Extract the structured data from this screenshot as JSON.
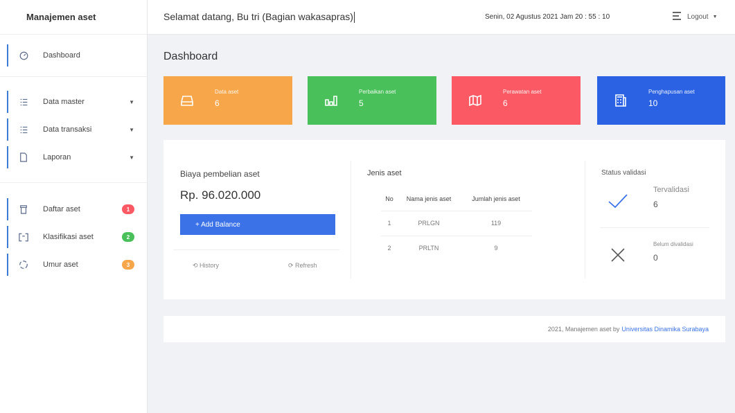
{
  "brand": "Manajemen aset",
  "topbar": {
    "welcome": "Selamat datang, Bu tri (Bagian wakasapras)",
    "datetime": "Senin, 02 Agustus 2021  Jam 20 : 55 : 10",
    "logout": "Logout"
  },
  "sidebar": {
    "dashboard": "Dashboard",
    "data_master": "Data master",
    "data_transaksi": "Data transaksi",
    "laporan": "Laporan",
    "daftar_aset": "Daftar aset",
    "klasifikasi_aset": "Klasifikasi aset",
    "umur_aset": "Umur aset"
  },
  "page_title": "Dashboard",
  "cards": [
    {
      "label": "Data aset",
      "value": "6",
      "color": "#f7a64a"
    },
    {
      "label": "Perbaikan aset",
      "value": "5",
      "color": "#49c05a"
    },
    {
      "label": "Perawatan aset",
      "value": "6",
      "color": "#fb5a64"
    },
    {
      "label": "Penghapusan aset",
      "value": "10",
      "color": "#2b62e3"
    }
  ],
  "biaya": {
    "title": "Biaya pembelian aset",
    "value": "Rp. 96.020.000",
    "add_button": "+ Add Balance",
    "history": "History",
    "refresh": "Refresh"
  },
  "jenis": {
    "title": "Jenis aset",
    "headers": [
      "No",
      "Nama jenis aset",
      "Jumlah jenis aset"
    ],
    "rows": [
      [
        "1",
        "PRLGN",
        "119"
      ],
      [
        "2",
        "PRLTN",
        "9"
      ]
    ]
  },
  "status": {
    "title": "Status validasi",
    "validated_label": "Tervalidasi",
    "validated_value": "6",
    "unvalidated_label": "Belum divalidasi",
    "unvalidated_value": "0"
  },
  "footer": {
    "text": "2021, Manajemen aset by",
    "link": "Universitas Dinamika Surabaya"
  }
}
